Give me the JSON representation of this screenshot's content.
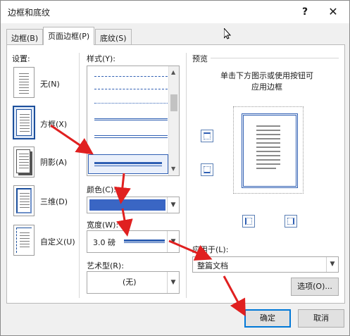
{
  "window": {
    "title": "边框和底纹",
    "help": "?",
    "close": "✕"
  },
  "tabs": [
    {
      "label": "边框(B)",
      "active": false
    },
    {
      "label": "页面边框(P)",
      "active": true
    },
    {
      "label": "底纹(S)",
      "active": false
    }
  ],
  "settings": {
    "heading": "设置:",
    "items": [
      {
        "label": "无(N)"
      },
      {
        "label": "方框(X)",
        "selected": true
      },
      {
        "label": "阴影(A)"
      },
      {
        "label": "三维(D)"
      },
      {
        "label": "自定义(U)"
      }
    ]
  },
  "style": {
    "heading": "样式(Y):"
  },
  "color": {
    "heading": "颜色(C):",
    "value": "#3a66c4"
  },
  "width": {
    "heading": "宽度(W):",
    "value": "3.0 磅"
  },
  "art": {
    "heading": "艺术型(R):",
    "value": "(无)"
  },
  "preview": {
    "heading": "预览",
    "hint_line1": "单击下方图示或使用按钮可",
    "hint_line2": "应用边框"
  },
  "apply_to": {
    "heading": "应用于(L):",
    "value": "整篇文档"
  },
  "buttons": {
    "options": "选项(O)...",
    "ok": "确定",
    "cancel": "取消"
  },
  "colors": {
    "accent": "#0078d7",
    "border_blue": "#2f5fb3",
    "arrow_red": "#e02020"
  }
}
